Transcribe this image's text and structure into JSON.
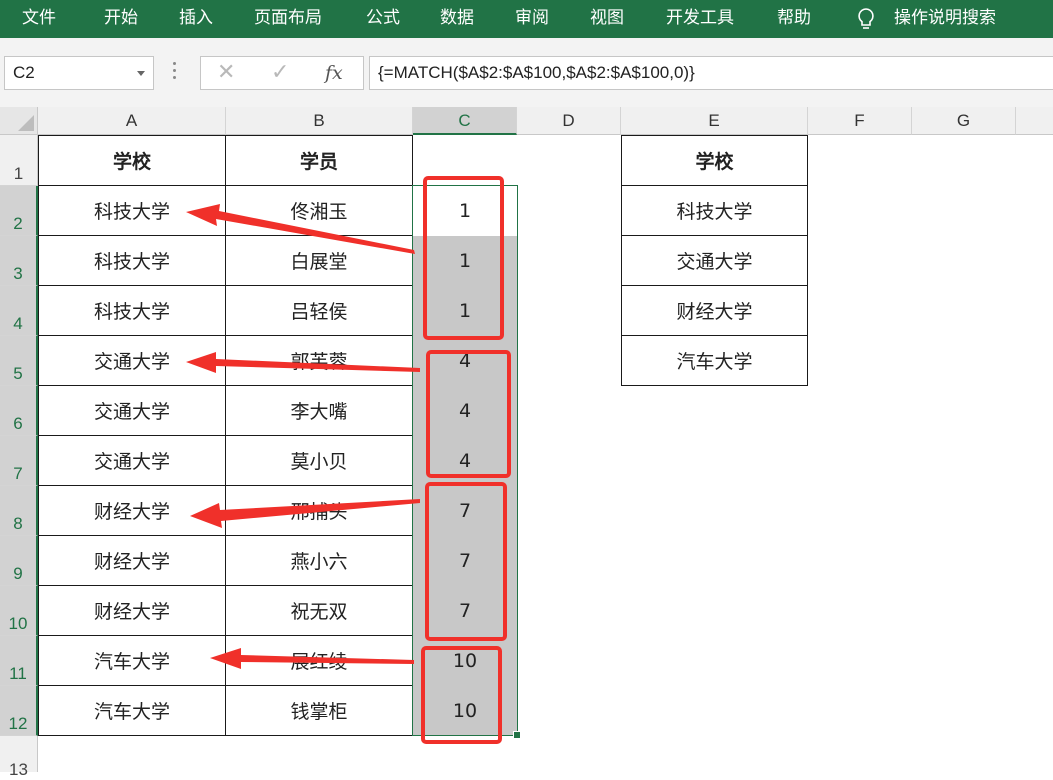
{
  "ribbon": {
    "tabs": [
      "文件",
      "开始",
      "插入",
      "页面布局",
      "公式",
      "数据",
      "审阅",
      "视图",
      "开发工具",
      "帮助"
    ],
    "search_label": "操作说明搜索"
  },
  "formula_bar": {
    "name_box": "C2",
    "formula": "{=MATCH($A$2:$A$100,$A$2:$A$100,0)}",
    "fx_label": "fx"
  },
  "columns": [
    "A",
    "B",
    "C",
    "D",
    "E",
    "F",
    "G"
  ],
  "rows": [
    "1",
    "2",
    "3",
    "4",
    "5",
    "6",
    "7",
    "8",
    "9",
    "10",
    "11",
    "12",
    "13"
  ],
  "table_main": {
    "headers": [
      "学校",
      "学员"
    ],
    "rows": [
      [
        "科技大学",
        "佟湘玉",
        "1"
      ],
      [
        "科技大学",
        "白展堂",
        "1"
      ],
      [
        "科技大学",
        "吕轻侯",
        "1"
      ],
      [
        "交通大学",
        "郭芙蓉",
        "4"
      ],
      [
        "交通大学",
        "李大嘴",
        "4"
      ],
      [
        "交通大学",
        "莫小贝",
        "4"
      ],
      [
        "财经大学",
        "邢捕头",
        "7"
      ],
      [
        "财经大学",
        "燕小六",
        "7"
      ],
      [
        "财经大学",
        "祝无双",
        "7"
      ],
      [
        "汽车大学",
        "展红绫",
        "10"
      ],
      [
        "汽车大学",
        "钱掌柜",
        "10"
      ]
    ]
  },
  "table_unique": {
    "header": "学校",
    "rows": [
      "科技大学",
      "交通大学",
      "财经大学",
      "汽车大学"
    ]
  },
  "colors": {
    "ribbon": "#217346",
    "annotation_red": "#f0302a",
    "selection_shade": "#c8c8c8"
  }
}
